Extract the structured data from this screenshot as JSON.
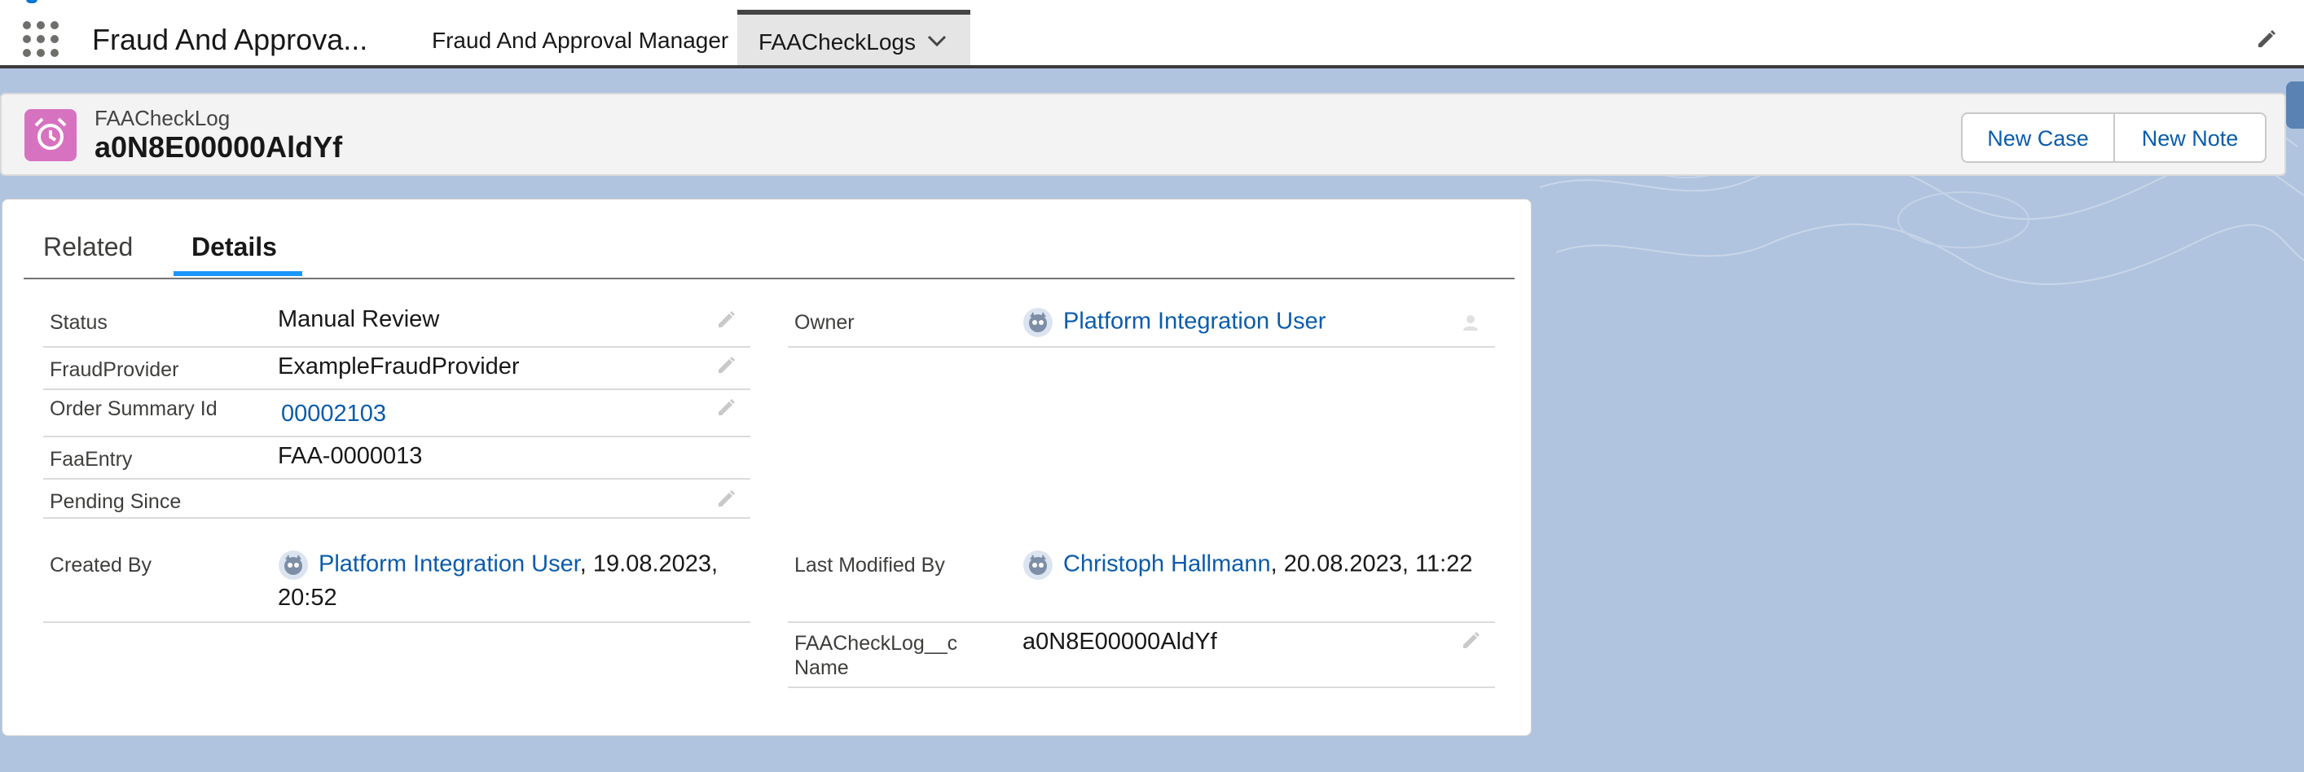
{
  "header": {
    "app_name": "Fraud And Approva...",
    "nav_items": [
      {
        "label": "Fraud And Approval Manager"
      },
      {
        "label": "FAACheckLogs"
      }
    ]
  },
  "record": {
    "object_label": "FAACheckLog",
    "title": "a0N8E00000AldYf",
    "actions": [
      "New Case",
      "New Note"
    ]
  },
  "tabs": [
    "Related",
    "Details"
  ],
  "details": {
    "status": {
      "label": "Status",
      "value": "Manual Review"
    },
    "fraud_provider": {
      "label": "FraudProvider",
      "value": "ExampleFraudProvider"
    },
    "order_summary": {
      "label": "Order Summary Id",
      "value": "00002103"
    },
    "faa_entry": {
      "label": "FaaEntry",
      "value": "FAA-0000013"
    },
    "pending_since": {
      "label": "Pending Since",
      "value": ""
    },
    "created_by": {
      "label": "Created By",
      "user": "Platform Integration User",
      "date_line1": ", 19.08.2023,",
      "date_line2": "20:52"
    },
    "owner": {
      "label": "Owner",
      "user": "Platform Integration User"
    },
    "last_modified_by": {
      "label": "Last Modified By",
      "user": "Christoph Hallmann",
      "date": ", 20.08.2023, 11:22"
    },
    "name": {
      "label_line1": "FAACheckLog__c",
      "label_line2": "Name",
      "value": "a0N8E00000AldYf"
    }
  },
  "colors": {
    "accent": "#0176d3",
    "link": "#0b5cab",
    "record_icon": "#d772c0",
    "tab_active": "#1b96ff",
    "background": "#b0c4df"
  },
  "icons": [
    "app-launcher-icon",
    "chevron-down-icon",
    "pencil-icon",
    "alarm-clock-icon",
    "user-avatar-icon"
  ]
}
